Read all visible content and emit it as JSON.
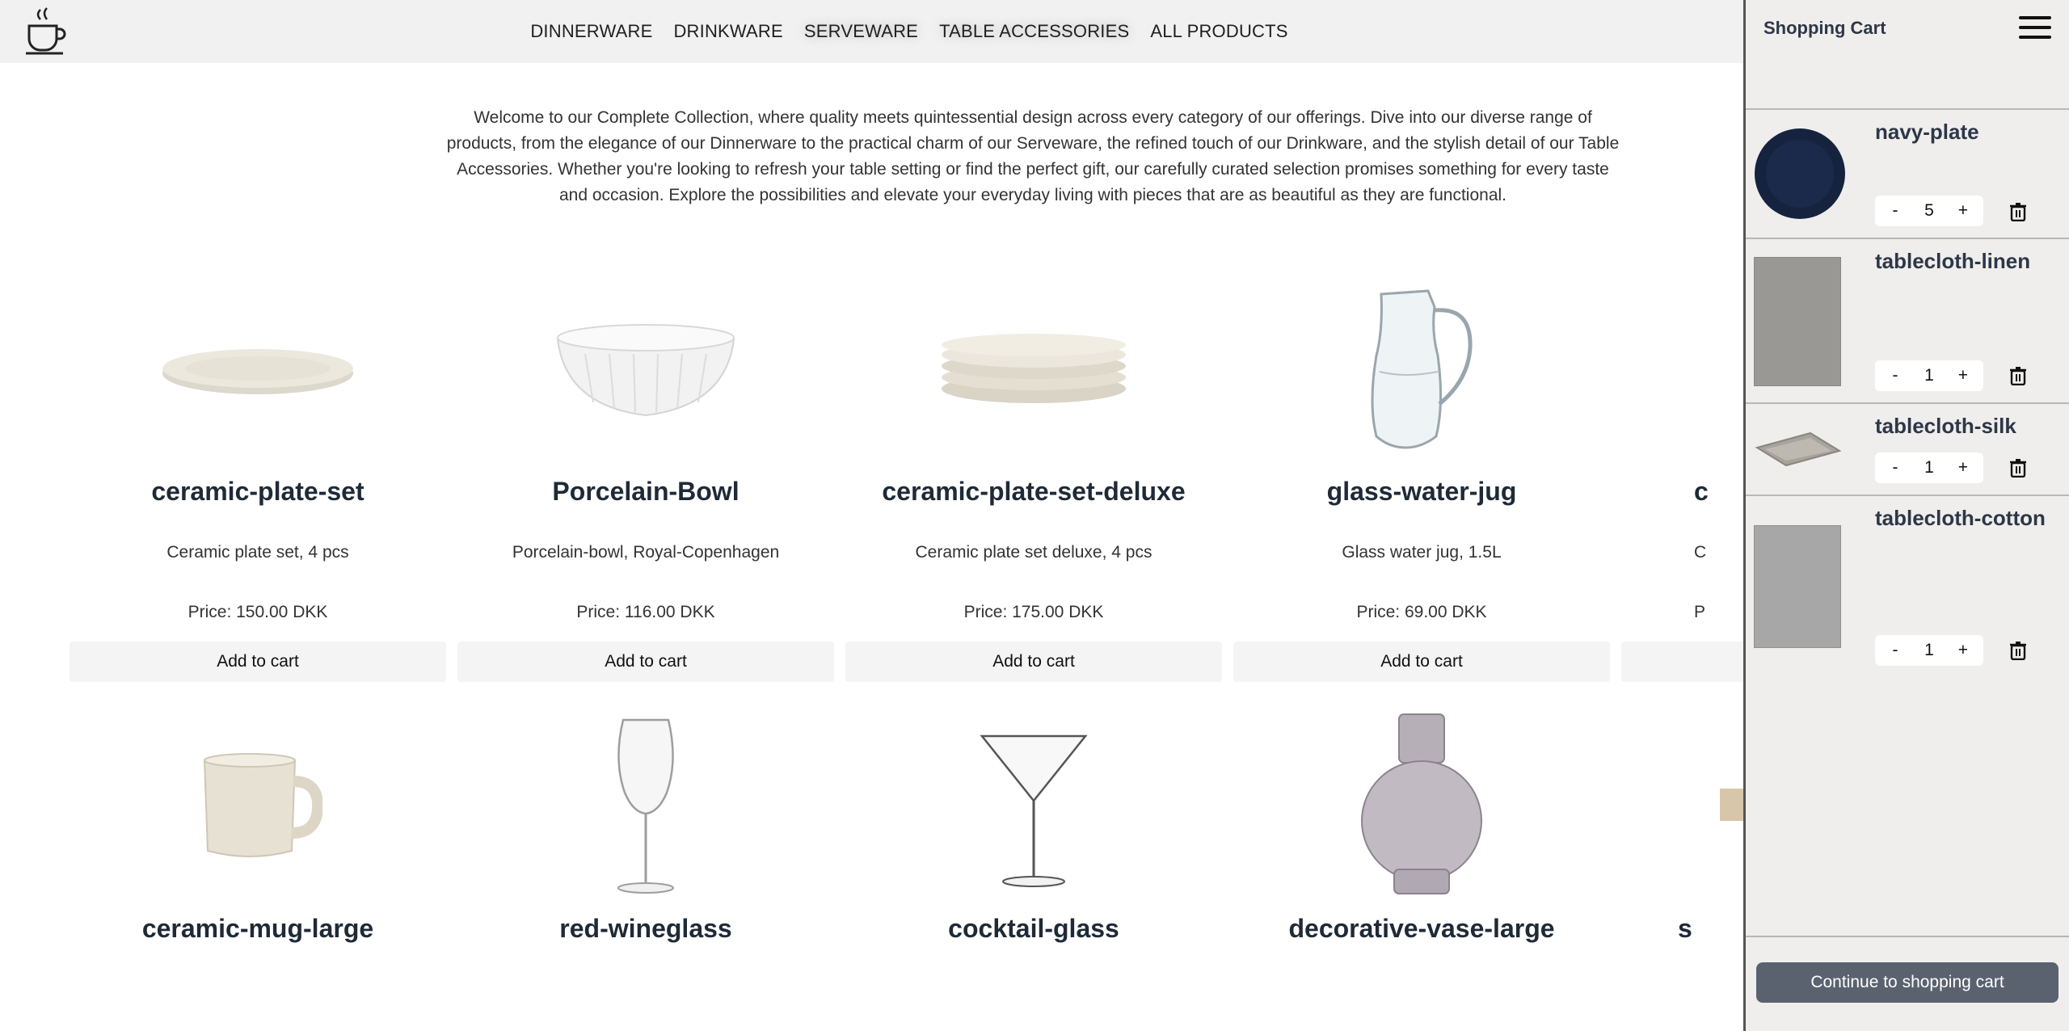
{
  "nav": {
    "items": [
      "DINNERWARE",
      "DRINKWARE",
      "SERVEWARE",
      "TABLE ACCESSORIES",
      "ALL PRODUCTS"
    ]
  },
  "intro": "Welcome to our Complete Collection, where quality meets quintessential design across every category of our offerings. Dive into our diverse range of products, from the elegance of our Dinnerware to the practical charm of our Serveware, the refined touch of our Drinkware, and the stylish detail of our Table Accessories. Whether you're looking to refresh your table setting or find the perfect gift, our carefully curated selection promises something for every taste and occasion. Explore the possibilities and elevate your everyday living with pieces that are as beautiful as they are functional.",
  "products": [
    {
      "name": "ceramic-plate-set",
      "desc": "Ceramic plate set, 4 pcs",
      "price": "Price: 150.00 DKK",
      "button": "Add to cart"
    },
    {
      "name": "Porcelain-Bowl",
      "desc": "Porcelain-bowl, Royal-Copenhagen",
      "price": "Price: 116.00 DKK",
      "button": "Add to cart"
    },
    {
      "name": "ceramic-plate-set-deluxe",
      "desc": "Ceramic plate set deluxe, 4 pcs",
      "price": "Price: 175.00 DKK",
      "button": "Add to cart"
    },
    {
      "name": "glass-water-jug",
      "desc": "Glass water jug, 1.5L",
      "price": "Price: 69.00 DKK",
      "button": "Add to cart"
    },
    {
      "name": "c",
      "desc": "C",
      "price": "P",
      "button": ""
    }
  ],
  "products_row2": [
    {
      "name": "ceramic-mug-large"
    },
    {
      "name": "red-wineglass"
    },
    {
      "name": "cocktail-glass"
    },
    {
      "name": "decorative-vase-large"
    },
    {
      "name": "s"
    }
  ],
  "cart": {
    "title": "Shopping Cart",
    "items": [
      {
        "name": "navy-plate",
        "qty": "5"
      },
      {
        "name": "tablecloth-linen",
        "qty": "1"
      },
      {
        "name": "tablecloth-silk",
        "qty": "1"
      },
      {
        "name": "tablecloth-cotton",
        "qty": "1"
      }
    ],
    "minus": "-",
    "plus": "+",
    "continue_label": "Continue to shopping cart"
  },
  "colors": {
    "header_bg": "#f1f1f1",
    "cart_bg": "#f0eeec",
    "continue_bg": "#5a6270",
    "navy": "#1b2a4a"
  }
}
